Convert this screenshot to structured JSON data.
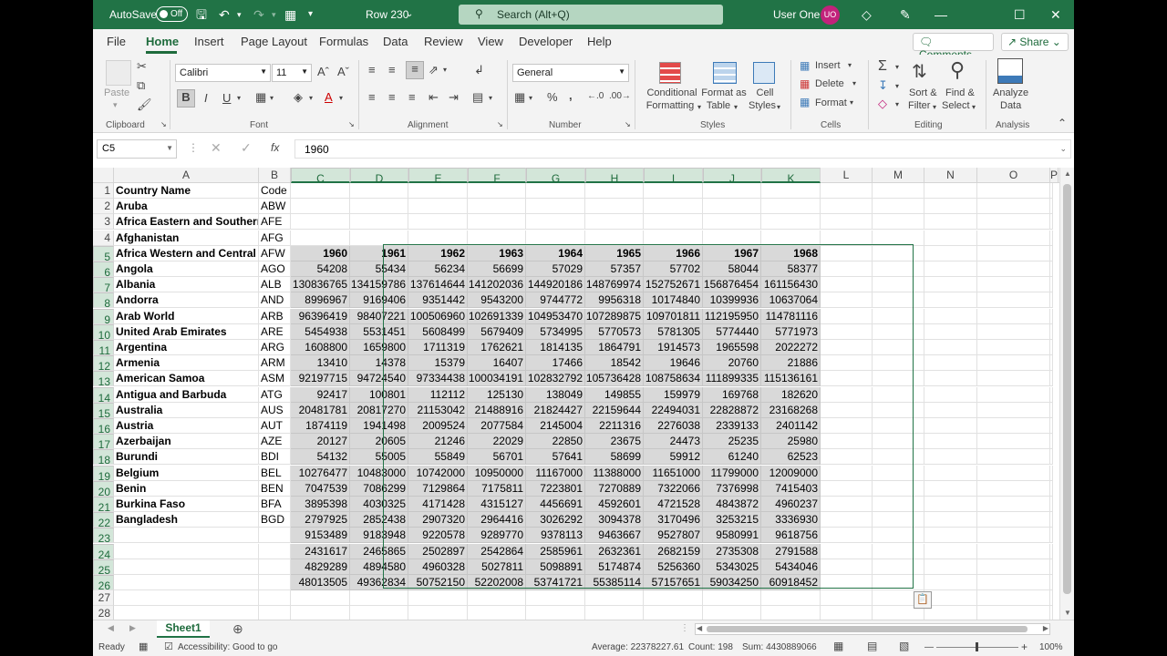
{
  "titlebar": {
    "autosave_label": "AutoSave",
    "autosave_state": "Off",
    "doc_title": "Row 230",
    "search_placeholder": "Search (Alt+Q)",
    "user_name": "User One",
    "user_initials": "UO"
  },
  "menu": {
    "tabs": [
      "File",
      "Home",
      "Insert",
      "Page Layout",
      "Formulas",
      "Data",
      "Review",
      "View",
      "Developer",
      "Help"
    ],
    "active": "Home",
    "comments": "Comments",
    "share": "Share"
  },
  "ribbon": {
    "clipboard": {
      "paste": "Paste",
      "group": "Clipboard"
    },
    "font": {
      "name": "Calibri",
      "size": "11",
      "group": "Font"
    },
    "alignment": {
      "group": "Alignment"
    },
    "number": {
      "format": "General",
      "group": "Number"
    },
    "styles": {
      "conditional": "Conditional",
      "conditional2": "Formatting",
      "format_as": "Format as",
      "format_as2": "Table",
      "cell": "Cell",
      "cell2": "Styles",
      "group": "Styles"
    },
    "cells": {
      "insert": "Insert",
      "delete": "Delete",
      "format": "Format",
      "group": "Cells"
    },
    "editing": {
      "sort": "Sort &",
      "sort2": "Filter",
      "find": "Find &",
      "find2": "Select",
      "group": "Editing"
    },
    "analysis": {
      "analyze": "Analyze",
      "analyze2": "Data",
      "group": "Analysis"
    }
  },
  "formula_bar": {
    "name_box": "C5",
    "fx": "fx",
    "value": "1960"
  },
  "columns": [
    "A",
    "B",
    "C",
    "D",
    "E",
    "F",
    "G",
    "H",
    "I",
    "J",
    "K",
    "L",
    "M",
    "N",
    "O",
    "P"
  ],
  "rows": {
    "col_a": [
      "Country Name",
      "Aruba",
      "Africa Eastern and Southern",
      "Afghanistan",
      "Africa Western and Central",
      "Angola",
      "Albania",
      "Andorra",
      "Arab World",
      "United Arab Emirates",
      "Argentina",
      "Armenia",
      "American Samoa",
      "Antigua and Barbuda",
      "Australia",
      "Austria",
      "Azerbaijan",
      "Burundi",
      "Belgium",
      "Benin",
      "Burkina Faso",
      "Bangladesh",
      "",
      "",
      "",
      "",
      "",
      ""
    ],
    "col_b": [
      "Code",
      "ABW",
      "AFE",
      "AFG",
      "AFW",
      "AGO",
      "ALB",
      "AND",
      "ARB",
      "ARE",
      "ARG",
      "ARM",
      "ASM",
      "ATG",
      "AUS",
      "AUT",
      "AZE",
      "BDI",
      "BEL",
      "BEN",
      "BFA",
      "BGD",
      "",
      "",
      "",
      "",
      "",
      ""
    ],
    "years": [
      "1960",
      "1961",
      "1962",
      "1963",
      "1964",
      "1965",
      "1966",
      "1967",
      "1968"
    ],
    "data": [
      [
        "54208",
        "55434",
        "56234",
        "56699",
        "57029",
        "57357",
        "57702",
        "58044",
        "58377"
      ],
      [
        "130836765",
        "134159786",
        "137614644",
        "141202036",
        "144920186",
        "148769974",
        "152752671",
        "156876454",
        "161156430"
      ],
      [
        "8996967",
        "9169406",
        "9351442",
        "9543200",
        "9744772",
        "9956318",
        "10174840",
        "10399936",
        "10637064"
      ],
      [
        "96396419",
        "98407221",
        "100506960",
        "102691339",
        "104953470",
        "107289875",
        "109701811",
        "112195950",
        "114781116"
      ],
      [
        "5454938",
        "5531451",
        "5608499",
        "5679409",
        "5734995",
        "5770573",
        "5781305",
        "5774440",
        "5771973"
      ],
      [
        "1608800",
        "1659800",
        "1711319",
        "1762621",
        "1814135",
        "1864791",
        "1914573",
        "1965598",
        "2022272"
      ],
      [
        "13410",
        "14378",
        "15379",
        "16407",
        "17466",
        "18542",
        "19646",
        "20760",
        "21886"
      ],
      [
        "92197715",
        "94724540",
        "97334438",
        "100034191",
        "102832792",
        "105736428",
        "108758634",
        "111899335",
        "115136161"
      ],
      [
        "92417",
        "100801",
        "112112",
        "125130",
        "138049",
        "149855",
        "159979",
        "169768",
        "182620"
      ],
      [
        "20481781",
        "20817270",
        "21153042",
        "21488916",
        "21824427",
        "22159644",
        "22494031",
        "22828872",
        "23168268"
      ],
      [
        "1874119",
        "1941498",
        "2009524",
        "2077584",
        "2145004",
        "2211316",
        "2276038",
        "2339133",
        "2401142"
      ],
      [
        "20127",
        "20605",
        "21246",
        "22029",
        "22850",
        "23675",
        "24473",
        "25235",
        "25980"
      ],
      [
        "54132",
        "55005",
        "55849",
        "56701",
        "57641",
        "58699",
        "59912",
        "61240",
        "62523"
      ],
      [
        "10276477",
        "10483000",
        "10742000",
        "10950000",
        "11167000",
        "11388000",
        "11651000",
        "11799000",
        "12009000"
      ],
      [
        "7047539",
        "7086299",
        "7129864",
        "7175811",
        "7223801",
        "7270889",
        "7322066",
        "7376998",
        "7415403"
      ],
      [
        "3895398",
        "4030325",
        "4171428",
        "4315127",
        "4456691",
        "4592601",
        "4721528",
        "4843872",
        "4960237"
      ],
      [
        "2797925",
        "2852438",
        "2907320",
        "2964416",
        "3026292",
        "3094378",
        "3170496",
        "3253215",
        "3336930"
      ],
      [
        "9153489",
        "9183948",
        "9220578",
        "9289770",
        "9378113",
        "9463667",
        "9527807",
        "9580991",
        "9618756"
      ],
      [
        "2431617",
        "2465865",
        "2502897",
        "2542864",
        "2585961",
        "2632361",
        "2682159",
        "2735308",
        "2791588"
      ],
      [
        "4829289",
        "4894580",
        "4960328",
        "5027811",
        "5098891",
        "5174874",
        "5256360",
        "5343025",
        "5434046"
      ],
      [
        "48013505",
        "49362834",
        "50752150",
        "52202008",
        "53741721",
        "55385114",
        "57157651",
        "59034250",
        "60918452"
      ]
    ]
  },
  "sheets": [
    "Sheet1"
  ],
  "status": {
    "ready": "Ready",
    "accessibility": "Accessibility: Good to go",
    "average": "Average: 22378227.61",
    "count": "Count: 198",
    "sum": "Sum: 4430889066",
    "zoom": "100%"
  },
  "colors": {
    "accent": "#217346",
    "selection": "#d9d9d9",
    "avatar": "#c2227b"
  }
}
